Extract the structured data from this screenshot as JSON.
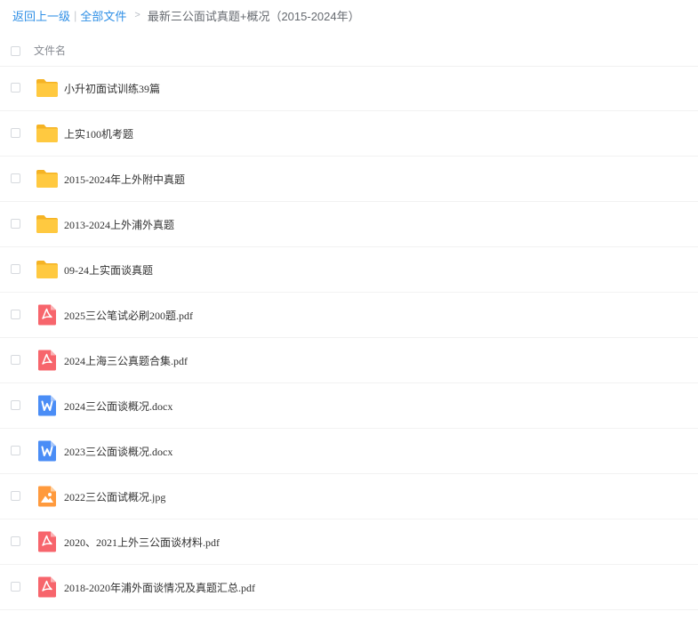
{
  "breadcrumb": {
    "back": "返回上一级",
    "separator": "|",
    "all_files": "全部文件",
    "arrow": ">",
    "current": "最新三公面试真题+概况（2015-2024年）"
  },
  "table": {
    "column_name": "文件名"
  },
  "files": [
    {
      "name": "小升初面试训练39篇",
      "icon": "folder-icon"
    },
    {
      "name": "上实100机考题",
      "icon": "folder-icon"
    },
    {
      "name": "2015-2024年上外附中真题",
      "icon": "folder-icon"
    },
    {
      "name": "2013-2024上外浦外真题",
      "icon": "folder-icon"
    },
    {
      "name": "09-24上实面谈真题",
      "icon": "folder-icon"
    },
    {
      "name": "2025三公笔试必刷200题.pdf",
      "icon": "pdf-icon"
    },
    {
      "name": "2024上海三公真题合集.pdf",
      "icon": "pdf-icon"
    },
    {
      "name": "2024三公面谈概况.docx",
      "icon": "word-icon"
    },
    {
      "name": "2023三公面谈概况.docx",
      "icon": "word-icon"
    },
    {
      "name": "2022三公面试概况.jpg",
      "icon": "image-icon"
    },
    {
      "name": "2020、2021上外三公面谈材料.pdf",
      "icon": "pdf-icon"
    },
    {
      "name": "2018-2020年浦外面谈情况及真题汇总.pdf",
      "icon": "pdf-icon"
    }
  ],
  "colors": {
    "link": "#2f8fe6",
    "folder": "#ffc940",
    "pdf": "#f7656c",
    "word": "#4a8df6",
    "image": "#ff9a3d"
  }
}
